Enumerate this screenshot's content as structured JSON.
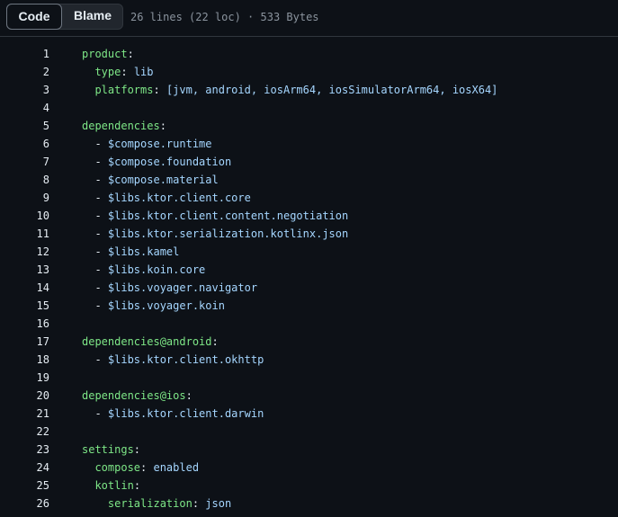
{
  "toolbar": {
    "code_label": "Code",
    "blame_label": "Blame",
    "file_info": "26 lines (22 loc) · 533 Bytes"
  },
  "colors": {
    "background": "#0d1117",
    "key": "#7ee787",
    "value": "#a5d6ff",
    "text": "#e6edf3",
    "muted": "#8b949e"
  },
  "code": {
    "lines": [
      {
        "n": "1",
        "indent": "",
        "dash": "",
        "key": "product",
        "colon": ":",
        "value": ""
      },
      {
        "n": "2",
        "indent": "  ",
        "dash": "",
        "key": "type",
        "colon": ": ",
        "value": "lib"
      },
      {
        "n": "3",
        "indent": "  ",
        "dash": "",
        "key": "platforms",
        "colon": ": ",
        "value": "[jvm, android, iosArm64, iosSimulatorArm64, iosX64]"
      },
      {
        "n": "4",
        "indent": "",
        "dash": "",
        "key": "",
        "colon": "",
        "value": ""
      },
      {
        "n": "5",
        "indent": "",
        "dash": "",
        "key": "dependencies",
        "colon": ":",
        "value": ""
      },
      {
        "n": "6",
        "indent": "  ",
        "dash": "- ",
        "key": "",
        "colon": "",
        "value": "$compose.runtime"
      },
      {
        "n": "7",
        "indent": "  ",
        "dash": "- ",
        "key": "",
        "colon": "",
        "value": "$compose.foundation"
      },
      {
        "n": "8",
        "indent": "  ",
        "dash": "- ",
        "key": "",
        "colon": "",
        "value": "$compose.material"
      },
      {
        "n": "9",
        "indent": "  ",
        "dash": "- ",
        "key": "",
        "colon": "",
        "value": "$libs.ktor.client.core"
      },
      {
        "n": "10",
        "indent": "  ",
        "dash": "- ",
        "key": "",
        "colon": "",
        "value": "$libs.ktor.client.content.negotiation"
      },
      {
        "n": "11",
        "indent": "  ",
        "dash": "- ",
        "key": "",
        "colon": "",
        "value": "$libs.ktor.serialization.kotlinx.json"
      },
      {
        "n": "12",
        "indent": "  ",
        "dash": "- ",
        "key": "",
        "colon": "",
        "value": "$libs.kamel"
      },
      {
        "n": "13",
        "indent": "  ",
        "dash": "- ",
        "key": "",
        "colon": "",
        "value": "$libs.koin.core"
      },
      {
        "n": "14",
        "indent": "  ",
        "dash": "- ",
        "key": "",
        "colon": "",
        "value": "$libs.voyager.navigator"
      },
      {
        "n": "15",
        "indent": "  ",
        "dash": "- ",
        "key": "",
        "colon": "",
        "value": "$libs.voyager.koin"
      },
      {
        "n": "16",
        "indent": "",
        "dash": "",
        "key": "",
        "colon": "",
        "value": ""
      },
      {
        "n": "17",
        "indent": "",
        "dash": "",
        "key": "dependencies@android",
        "colon": ":",
        "value": ""
      },
      {
        "n": "18",
        "indent": "  ",
        "dash": "- ",
        "key": "",
        "colon": "",
        "value": "$libs.ktor.client.okhttp"
      },
      {
        "n": "19",
        "indent": "",
        "dash": "",
        "key": "",
        "colon": "",
        "value": ""
      },
      {
        "n": "20",
        "indent": "",
        "dash": "",
        "key": "dependencies@ios",
        "colon": ":",
        "value": ""
      },
      {
        "n": "21",
        "indent": "  ",
        "dash": "- ",
        "key": "",
        "colon": "",
        "value": "$libs.ktor.client.darwin"
      },
      {
        "n": "22",
        "indent": "",
        "dash": "",
        "key": "",
        "colon": "",
        "value": ""
      },
      {
        "n": "23",
        "indent": "",
        "dash": "",
        "key": "settings",
        "colon": ":",
        "value": ""
      },
      {
        "n": "24",
        "indent": "  ",
        "dash": "",
        "key": "compose",
        "colon": ": ",
        "value": "enabled"
      },
      {
        "n": "25",
        "indent": "  ",
        "dash": "",
        "key": "kotlin",
        "colon": ":",
        "value": ""
      },
      {
        "n": "26",
        "indent": "    ",
        "dash": "",
        "key": "serialization",
        "colon": ": ",
        "value": "json"
      }
    ]
  }
}
